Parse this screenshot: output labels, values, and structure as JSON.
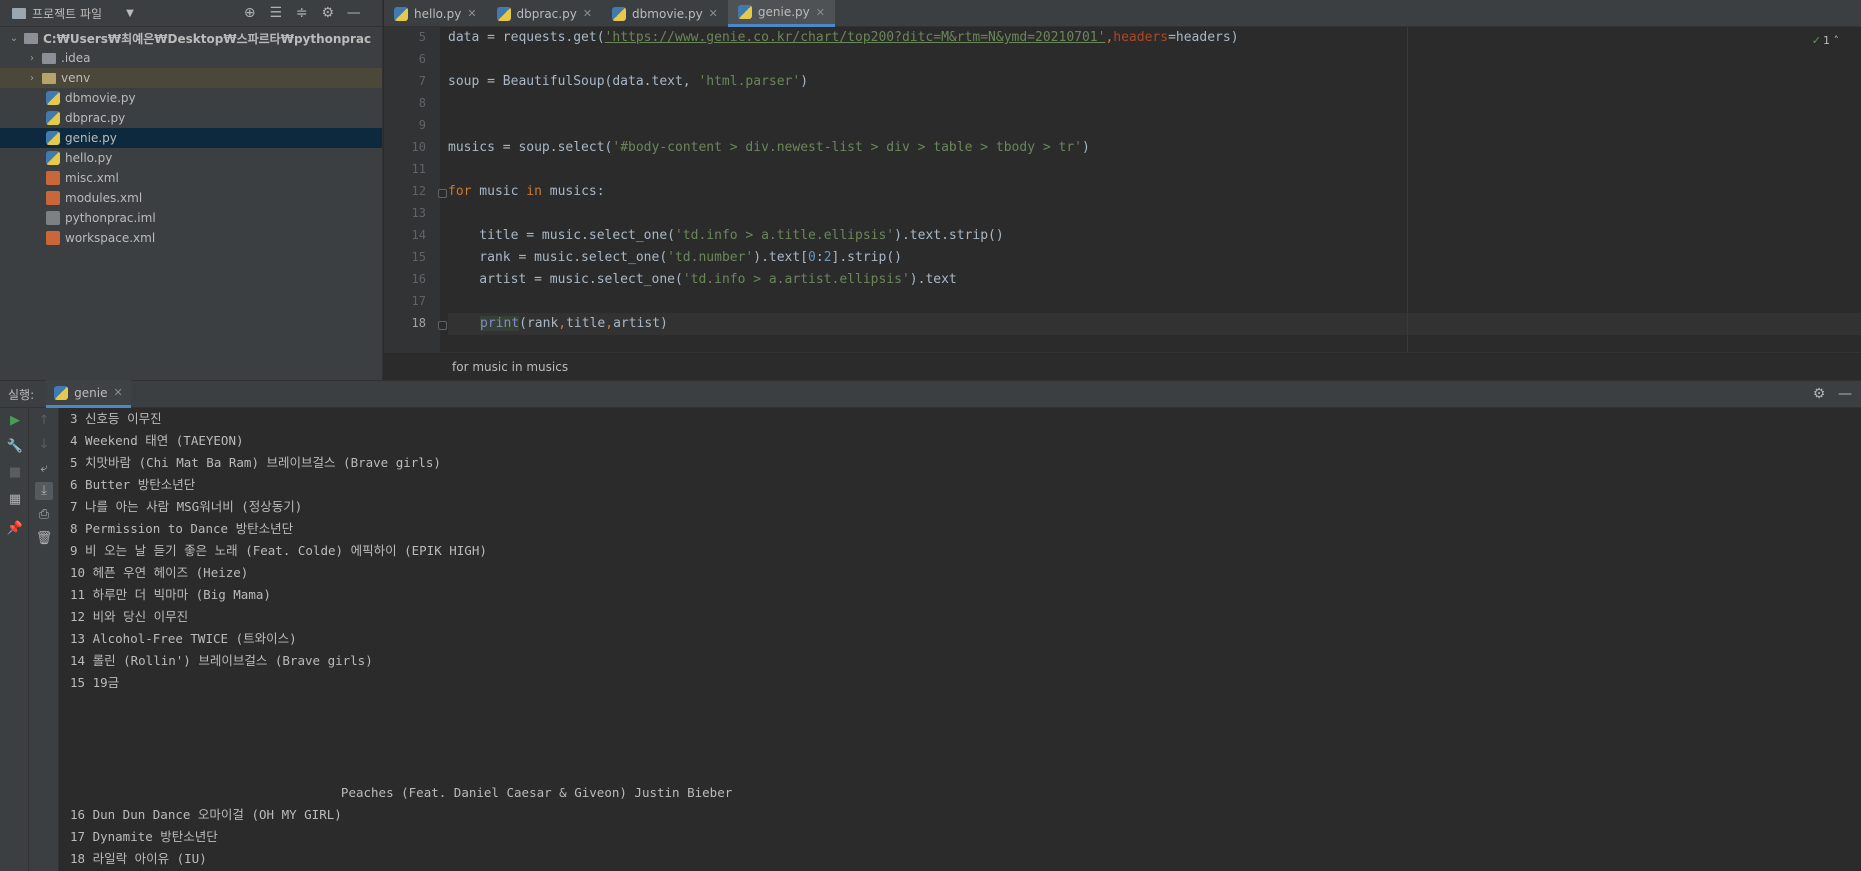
{
  "project": {
    "title": "프로젝트 파일",
    "tree": [
      {
        "label": "C:₩Users₩최예은₩Desktop₩스파르타₩pythonprac",
        "kind": "root"
      },
      {
        "label": ".idea",
        "kind": "folder"
      },
      {
        "label": "venv",
        "kind": "folder"
      },
      {
        "label": "dbmovie.py",
        "kind": "py"
      },
      {
        "label": "dbprac.py",
        "kind": "py"
      },
      {
        "label": "genie.py",
        "kind": "py"
      },
      {
        "label": "hello.py",
        "kind": "py"
      },
      {
        "label": "misc.xml",
        "kind": "xml"
      },
      {
        "label": "modules.xml",
        "kind": "xml"
      },
      {
        "label": "pythonprac.iml",
        "kind": "iml"
      },
      {
        "label": "workspace.xml",
        "kind": "xml"
      }
    ]
  },
  "tabs": [
    "hello.py",
    "dbprac.py",
    "dbmovie.py",
    "genie.py"
  ],
  "editor": {
    "line_numbers": [
      "5",
      "6",
      "7",
      "8",
      "9",
      "10",
      "11",
      "12",
      "13",
      "14",
      "15",
      "16",
      "17",
      "18"
    ],
    "code": {
      "l5a": "data = requests.get(",
      "l5b": "'https://www.genie.co.kr/chart/top200?ditc=M&rtm=N&ymd=20210701'",
      "l5c": ",",
      "l5d": "headers",
      "l5e": "=headers)",
      "l7a": "soup = BeautifulSoup(data.text, ",
      "l7b": "'html.parser'",
      "l7c": ")",
      "l10a": "musics = soup.select(",
      "l10b": "'#body-content > div.newest-list > div > table > tbody > tr'",
      "l10c": ")",
      "l12a": "for",
      "l12b": " music ",
      "l12c": "in",
      "l12d": " musics:",
      "l14a": "    title = music.select_one(",
      "l14b": "'td.info > a.title.ellipsis'",
      "l14c": ").text.strip()",
      "l15a": "    rank = music.select_one(",
      "l15b": "'td.number'",
      "l15c": ").text[",
      "l15d": "0",
      "l15e": ":",
      "l15f": "2",
      "l15g": "].strip()",
      "l16a": "    artist = music.select_one(",
      "l16b": "'td.info > a.artist.ellipsis'",
      "l16c": ").text",
      "l18a": "print",
      "l18b": "(rank",
      "l18c": ",",
      "l18d": "title",
      "l18e": ",",
      "l18f": "artist)"
    },
    "inspection_count": "1"
  },
  "breadcrumb": "for music in musics",
  "run": {
    "label": "실행:",
    "tab": "genie",
    "output": [
      "3 신호등 이무진",
      "4 Weekend 태연 (TAEYEON)",
      "5 치맛바람 (Chi Mat Ba Ram) 브레이브걸스 (Brave girls)",
      "6 Butter 방탄소년단",
      "7 나를 아는 사람 MSG워너비 (정상동기)",
      "8 Permission to Dance 방탄소년단",
      "9 비 오는 날 듣기 좋은 노래 (Feat. Colde) 에픽하이 (EPIK HIGH)",
      "10 헤픈 우연 헤이즈 (Heize)",
      "11 하루만 더 빅마마 (Big Mama)",
      "12 비와 당신 이무진",
      "13 Alcohol-Free TWICE (트와이스)",
      "14 롤린 (Rollin') 브레이브걸스 (Brave girls)",
      "15 19금",
      "                                    Peaches (Feat. Daniel Caesar & Giveon) Justin Bieber",
      "16 Dun Dun Dance 오마이걸 (OH MY GIRL)",
      "17 Dynamite 방탄소년단",
      "18 라일락 아이유 (IU)"
    ]
  }
}
